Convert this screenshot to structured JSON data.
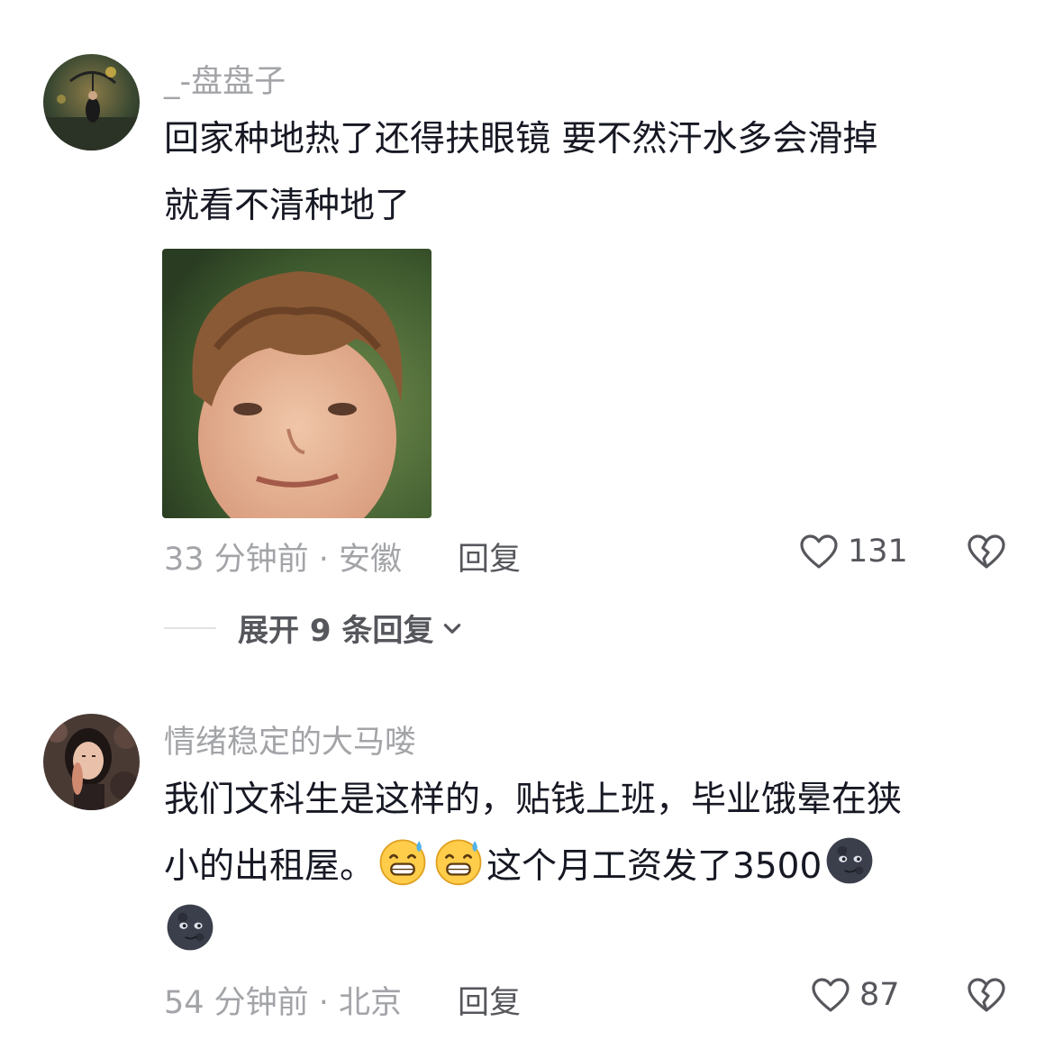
{
  "comments": [
    {
      "username": "_-盘盘子",
      "content_lines": [
        "回家种地热了还得扶眼镜 要不然汗水多会滑掉",
        "就看不清种地了"
      ],
      "time": "33 分钟前 · 安徽",
      "reply_label": "回复",
      "likes": "131",
      "has_sticker": true,
      "sticker_icon": "boy-face-sticker"
    },
    {
      "username": "情绪稳定的大马喽",
      "content_line1": "我们文科生是这样的，贴钱上班，毕业饿晕在狭",
      "content_line2_a": "小的出租屋。",
      "content_line2_b": "这个月工资发了3500",
      "emojis": [
        "sweat-grin-emoji",
        "sweat-grin-emoji",
        "dark-moon-face-emoji",
        "dark-moon-face-emoji"
      ],
      "time": "54 分钟前 · 北京",
      "reply_label": "回复",
      "likes": "87"
    }
  ],
  "expand_replies": {
    "label": "展开 9 条回复"
  },
  "colors": {
    "primary_text": "#161823",
    "secondary_text": "#a3a4a8",
    "action_text": "#56575c"
  }
}
